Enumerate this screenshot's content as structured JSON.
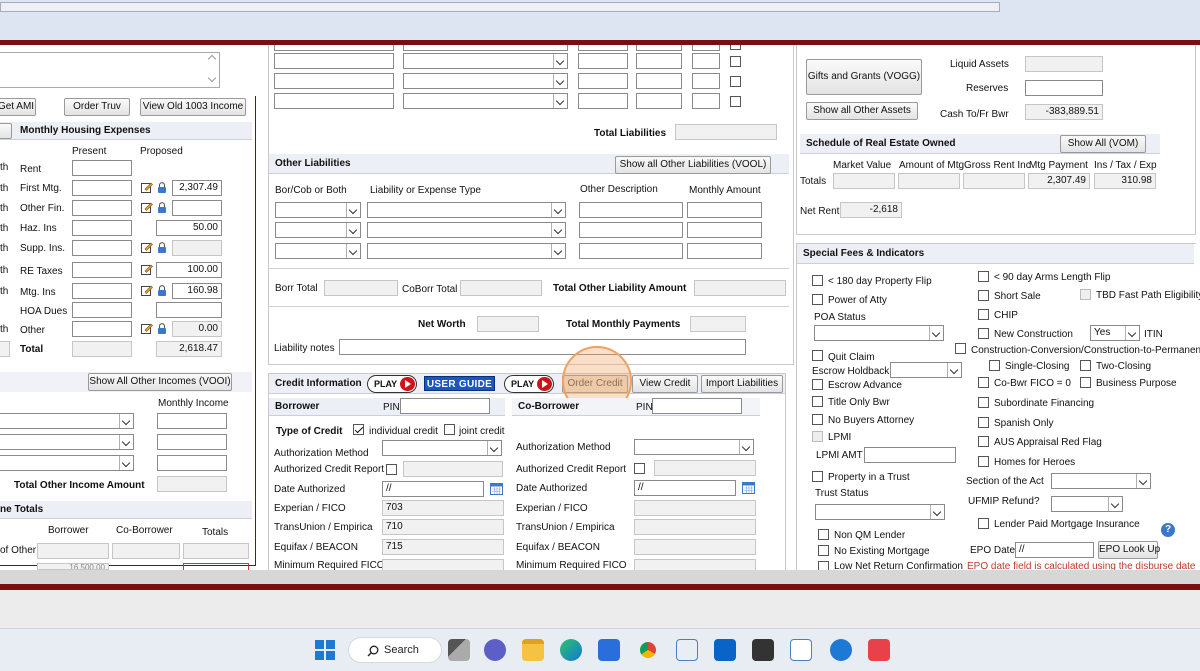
{
  "colors": {
    "dark_red": "#7a0f12",
    "section_bg": "#eceff5",
    "order_credit_highlight": "#f0a060",
    "taskbar": "#e8ecf3",
    "play_red": "#d0121b",
    "user_guide_blue": "#1a56c4"
  },
  "left": {
    "buttons": {
      "get_ami": "Get AMI",
      "order_truv": "Order Truv",
      "view_old_1003": "View Old 1003 Income",
      "show_all_other_incomes": "Show All Other Incomes (VOOI)"
    },
    "housing": {
      "title": "Monthly Housing Expenses",
      "col_present": "Present",
      "col_proposed": "Proposed",
      "rows": [
        {
          "label": "Rent",
          "proposed": ""
        },
        {
          "label": "First Mtg.",
          "proposed": "2,307.49"
        },
        {
          "label": "Other Fin.",
          "proposed": ""
        },
        {
          "label": "Haz. Ins",
          "proposed": "50.00"
        },
        {
          "label": "Supp. Ins.",
          "proposed": ""
        },
        {
          "label": "RE Taxes",
          "proposed": "100.00"
        },
        {
          "label": "Mtg. Ins",
          "proposed": "160.98"
        },
        {
          "label": "HOA Dues",
          "proposed": ""
        },
        {
          "label": "Other",
          "proposed": "0.00"
        },
        {
          "label": "Total",
          "proposed": "2,618.47"
        }
      ],
      "clipped_prefix": "th"
    },
    "income": {
      "monthly_income": "Monthly Income",
      "total_other_income": "Total Other Income Amount"
    },
    "totals": {
      "title": "ne Totals",
      "borrower": "Borrower",
      "coborrower": "Co-Borrower",
      "totals": "Totals",
      "of_other": "of Other",
      "partial_value": "16,500.00"
    }
  },
  "middle": {
    "total_liabilities": "Total Liabilities",
    "other_liabilities": {
      "title": "Other Liabilities",
      "show_all": "Show all Other Liabilities (VOOL)",
      "col_bor": "Bor/Cob or Both",
      "col_type": "Liability or Expense Type",
      "col_desc": "Other Description",
      "col_amount": "Monthly Amount"
    },
    "borr_total": "Borr Total",
    "coborr_total": "CoBorr Total",
    "total_other_liability": "Total Other Liability Amount",
    "net_worth": "Net Worth",
    "total_monthly_payments": "Total Monthly Payments",
    "liability_notes": "Liability notes"
  },
  "credit": {
    "title": "Credit Information",
    "play": "PLAY",
    "user_guide": "USER GUIDE",
    "order_credit": "Order Credit",
    "view_credit": "View Credit",
    "import_liabilities": "Import Liabilities",
    "borrower": {
      "title": "Borrower",
      "pin": "PIN",
      "type_of_credit": "Type of Credit",
      "individual": "individual credit",
      "joint": "joint credit",
      "auth_method": "Authorization Method",
      "auth_report": "Authorized Credit Report",
      "date_auth": "Date Authorized",
      "date_value": "//",
      "experian": "Experian / FICO",
      "experian_val": "703",
      "transunion": "TransUnion / Empirica",
      "transunion_val": "710",
      "equifax": "Equifax / BEACON",
      "equifax_val": "715",
      "min_fico": "Minimum Required FICO"
    },
    "coborrower": {
      "title": "Co-Borrower",
      "pin": "PIN",
      "auth_method": "Authorization Method",
      "auth_report": "Authorized Credit Report",
      "date_auth": "Date Authorized",
      "date_value": "//",
      "experian": "Experian / FICO",
      "transunion": "TransUnion / Empirica",
      "equifax": "Equifax / BEACON",
      "min_fico": "Minimum Required FICO"
    }
  },
  "right": {
    "gifts_button": "Gifts and Grants (VOGG)",
    "liquid_assets": "Liquid Assets",
    "reserves": "Reserves",
    "show_other_assets": "Show all Other Assets",
    "cash_to_fr_bwr": "Cash To/Fr Bwr",
    "cash_value": "-383,889.51",
    "reo": {
      "title": "Schedule of Real Estate Owned",
      "show_all": "Show All (VOM)",
      "market_value": "Market Value",
      "amount_mtg": "Amount of Mtg",
      "gross_rent": "Gross Rent Inc",
      "mtg_payment": "Mtg Payment",
      "ins_tax": "Ins / Tax / Exp",
      "totals": "Totals",
      "mtg_val": "2,307.49",
      "ins_val": "310.98",
      "net_rent": "Net Rent",
      "net_rent_val": "-2,618"
    },
    "fees": {
      "title": "Special Fees & Indicators",
      "flip180": "< 180 day Property Flip",
      "power_atty": "Power of Atty",
      "poa_status": "POA Status",
      "quit_claim": "Quit Claim",
      "escrow_holdback": "Escrow Holdback",
      "escrow_advance": "Escrow Advance",
      "title_only": "Title Only Bwr",
      "no_buyers_atty": "No Buyers Attorney",
      "lpmi": "LPMI",
      "lpmi_amt": "LPMI AMT",
      "property_trust": "Property in a Trust",
      "trust_status": "Trust Status",
      "non_qm": "Non QM Lender",
      "no_existing_mtg": "No Existing Mortgage",
      "low_net_return": "Low Net Return Confirmation",
      "arms90": "< 90 day Arms Length Flip",
      "short_sale": "Short Sale",
      "tbd_fast": "TBD Fast Path Eligibility",
      "chip": "CHIP",
      "new_construction": "New Construction",
      "new_construction_val": "Yes",
      "itin": "ITIN",
      "ccp": "Construction-Conversion/Construction-to-Permanent",
      "single_closing": "Single-Closing",
      "two_closing": "Two-Closing",
      "cobwr_fico": "Co-Bwr FICO = 0",
      "business_purpose": "Business Purpose",
      "subordinate": "Subordinate Financing",
      "spanish": "Spanish Only",
      "aus_red_flag": "AUS Appraisal Red Flag",
      "homes_heroes": "Homes for Heroes",
      "section_act": "Section of the Act",
      "ufmip_refund": "UFMIP Refund?",
      "lender_paid_mi": "Lender Paid Mortgage Insurance",
      "help": "?",
      "epo_date": "EPO Date",
      "epo_value": "//",
      "epo_lookup": "EPO Look Up",
      "epo_note": "EPO date field is calculated using the disburse date"
    }
  },
  "taskbar": {
    "search": "Search"
  }
}
